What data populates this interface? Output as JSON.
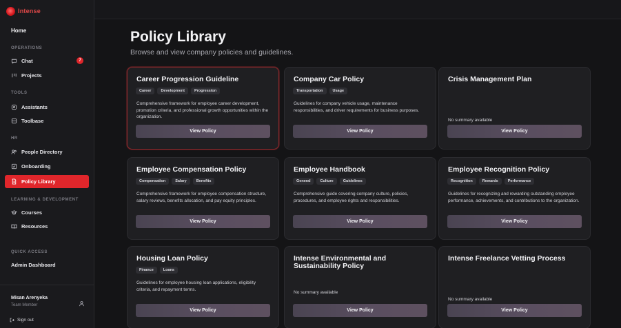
{
  "app": {
    "name": "Intense"
  },
  "sidebar": {
    "home": "Home",
    "sections": {
      "operations": "OPERATIONS",
      "tools": "TOOLS",
      "hr": "HR",
      "learning": "LEARNING & DEVELOPMENT",
      "quick_access": "QUICK ACCESS"
    },
    "items": {
      "chat": {
        "label": "Chat",
        "icon": "chat-bubble-icon",
        "badge": "7"
      },
      "projects": {
        "label": "Projects",
        "icon": "columns-icon"
      },
      "assistants": {
        "label": "Assistants",
        "icon": "assistant-icon"
      },
      "toolbase": {
        "label": "Toolbase",
        "icon": "database-icon"
      },
      "people": {
        "label": "People Directory",
        "icon": "people-icon"
      },
      "onboarding": {
        "label": "Onboarding",
        "icon": "checkbox-icon"
      },
      "policy": {
        "label": "Policy Library",
        "icon": "document-icon"
      },
      "courses": {
        "label": "Courses",
        "icon": "graduation-cap-icon"
      },
      "resources": {
        "label": "Resources",
        "icon": "book-icon"
      }
    },
    "admin": "Admin Dashboard",
    "user": {
      "name": "Misan Arenyeka",
      "role": "Team Member"
    },
    "signout": "Sign out"
  },
  "colors": {
    "accent": "#e0262b",
    "card_bg": "#1f1f22",
    "page_bg": "#141416"
  },
  "main": {
    "title": "Policy Library",
    "subtitle": "Browse and view company policies and guidelines.",
    "button_label": "View Policy",
    "cards": [
      {
        "title": "Career Progression Guideline",
        "tags": [
          "Career",
          "Development",
          "Progression"
        ],
        "summary": "Comprehensive framework for employee career development, promotion criteria, and professional growth opportunities within the organization."
      },
      {
        "title": "Company Car Policy",
        "tags": [
          "Transportation",
          "Usage"
        ],
        "summary": "Guidelines for company vehicle usage, maintenance responsibilities, and driver requirements for business purposes."
      },
      {
        "title": "Crisis Management Plan",
        "tags": [],
        "summary": "No summary available"
      },
      {
        "title": "Employee Compensation Policy",
        "tags": [
          "Compensation",
          "Salary",
          "Benefits"
        ],
        "summary": "Comprehensive framework for employee compensation structure, salary reviews, benefits allocation, and pay equity principles."
      },
      {
        "title": "Employee Handbook",
        "tags": [
          "General",
          "Culture",
          "Guidelines"
        ],
        "summary": "Comprehensive guide covering company culture, policies, procedures, and employee rights and responsibilities."
      },
      {
        "title": "Employee Recognition Policy",
        "tags": [
          "Recognition",
          "Rewards",
          "Performance"
        ],
        "summary": "Guidelines for recognizing and rewarding outstanding employee performance, achievements, and contributions to the organization."
      },
      {
        "title": "Housing Loan Policy",
        "tags": [
          "Finance",
          "Loans"
        ],
        "summary": "Guidelines for employee housing loan applications, eligibility criteria, and repayment terms."
      },
      {
        "title": "Intense Environmental and Sustainability Policy",
        "tags": [],
        "summary": "No summary available"
      },
      {
        "title": "Intense Freelance Vetting Process",
        "tags": [],
        "summary": "No summary available"
      }
    ]
  }
}
